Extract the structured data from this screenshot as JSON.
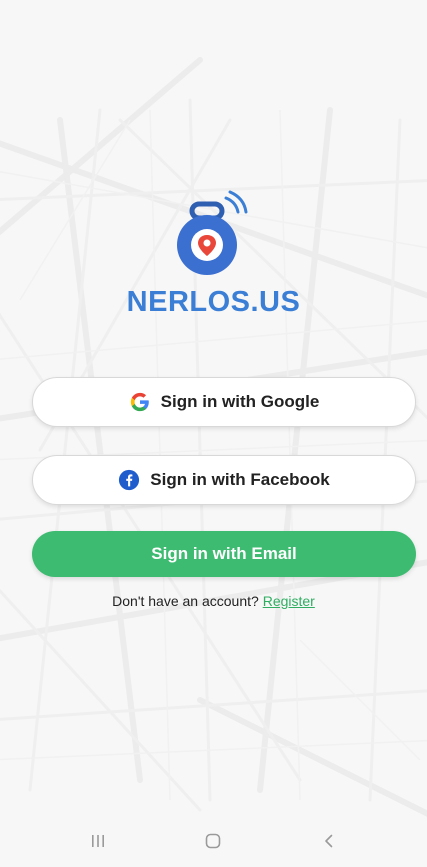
{
  "brand": {
    "name": "NERLOS.US",
    "color": "#3b7ed6",
    "logo_icon": "location-tracker-icon"
  },
  "buttons": {
    "google": {
      "label": "Sign in with Google",
      "icon": "google-icon"
    },
    "facebook": {
      "label": "Sign in with Facebook",
      "icon": "facebook-icon"
    },
    "email": {
      "label": "Sign in with Email",
      "color": "#3dbb70"
    }
  },
  "register": {
    "prompt": "Don't have an account?",
    "link_label": "Register",
    "link_color": "#2fae62"
  },
  "navbar": {
    "recents_icon": "recents-icon",
    "home_icon": "home-icon",
    "back_icon": "back-icon"
  },
  "background": {
    "icon": "map-background"
  }
}
